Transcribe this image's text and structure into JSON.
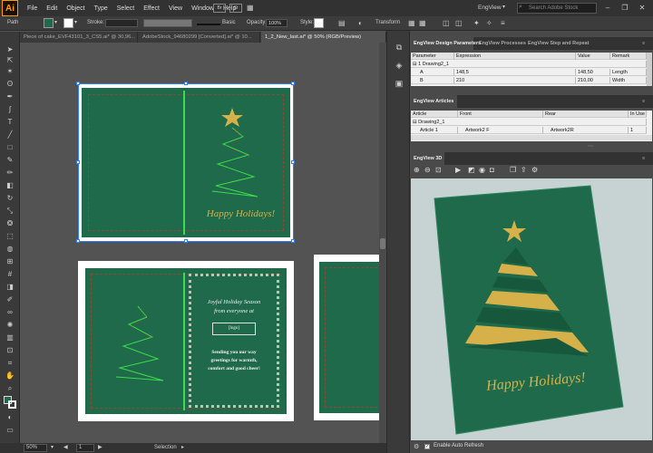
{
  "app": {
    "logo": "Ai",
    "menus": [
      "File",
      "Edit",
      "Object",
      "Type",
      "Select",
      "Effect",
      "View",
      "Window",
      "Help"
    ],
    "workspace": "EngView",
    "search_placeholder": "Search Adobe Stock"
  },
  "control_bar": {
    "selection_type": "Path",
    "stroke_label": "Stroke:",
    "brush": "Basic",
    "opacity_label": "Opacity:",
    "opacity_value": "100%",
    "style_label": "Style:",
    "transform_label": "Transform",
    "fill_color": "#1e6a4a"
  },
  "doc_tabs": [
    {
      "label": "Piece of cake_EVF43101_3_CS5.ai* @ 30,96..."
    },
    {
      "label": "AdobeStock_94680299 [Converted].ai* @ 10..."
    },
    {
      "label": "1_2_New_last.ai* @ 50% (RGB/Preview)"
    }
  ],
  "status": {
    "zoom": "50%",
    "page": "1",
    "mode": "Selection"
  },
  "cards": {
    "front_greeting": "Happy Holidays!",
    "inside_line1": "Joyful Holiday Season",
    "inside_line2": "from everyone at",
    "inside_logo": "[logo]",
    "inside_msg1": "Sending you our way",
    "inside_msg2": "greetings for warmth,",
    "inside_msg3": "comfort and good cheer!"
  },
  "design_params": {
    "tabs": [
      "EngView Design Parameters",
      "EngView Processes",
      "EngView Step and Repeat"
    ],
    "columns": [
      "Parameter",
      "Expression",
      "Value",
      "Remark"
    ],
    "rows": [
      {
        "param": "1 Drawing2_1",
        "expr": "",
        "value": "",
        "remark": ""
      },
      {
        "param": "A",
        "expr": "148,5",
        "value": "148,50",
        "remark": "Length"
      },
      {
        "param": "B",
        "expr": "210",
        "value": "210,00",
        "remark": "Width"
      }
    ]
  },
  "articles": {
    "tab": "EngView Articles",
    "columns": [
      "Article",
      "Front",
      "Rear",
      "In Use"
    ],
    "rows": [
      {
        "article": "Drawing2_1",
        "front": "",
        "rear": "",
        "inuse": ""
      },
      {
        "article": "Article 1",
        "front": "Artwork2 F",
        "rear": "Artwork2R",
        "inuse": "1"
      }
    ]
  },
  "viewer3d": {
    "tab": "EngView 3D",
    "greeting": "Happy Holidays!",
    "auto_refresh_label": "Enable Auto Refresh"
  },
  "colors": {
    "card_green": "#1e6a4a",
    "gold": "#d6b14a",
    "line_green": "#3ddc4a",
    "selection_blue": "#2f80ff"
  }
}
